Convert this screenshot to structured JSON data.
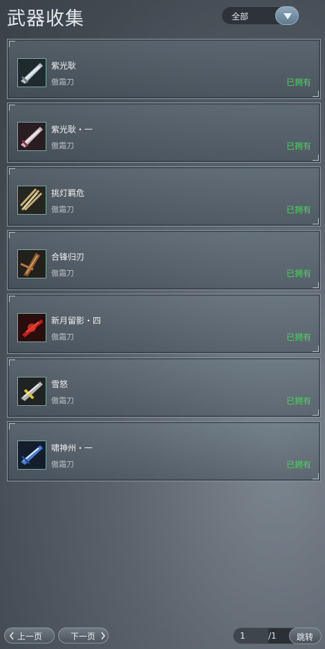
{
  "header": {
    "title": "武器收集",
    "filter_value": "全部"
  },
  "items": [
    {
      "name": "紫光耿",
      "category": "傲霜刀",
      "status": "已拥有",
      "icon": "blade-silver-icon"
    },
    {
      "name": "紫光耿・一",
      "category": "傲霜刀",
      "status": "已拥有",
      "icon": "blade-crimson-icon"
    },
    {
      "name": "挑灯羁危",
      "category": "傲霜刀",
      "status": "已拥有",
      "icon": "blade-gold-icon"
    },
    {
      "name": "合锋归刃",
      "category": "傲霜刀",
      "status": "已拥有",
      "icon": "blade-bronze-icon"
    },
    {
      "name": "新月留影・四",
      "category": "傲霜刀",
      "status": "已拥有",
      "icon": "blade-red-icon"
    },
    {
      "name": "雪怒",
      "category": "傲霜刀",
      "status": "已拥有",
      "icon": "blade-yellow-icon"
    },
    {
      "name": "啸神州・一",
      "category": "傲霜刀",
      "status": "已拥有",
      "icon": "blade-blue-icon"
    }
  ],
  "pager": {
    "prev_label": "上一页",
    "next_label": "下一页",
    "current_page": "1",
    "total_pages": "/1",
    "jump_label": "跳转"
  },
  "colors": {
    "owned": "#4dd25e",
    "accent": "#7fa7a2"
  }
}
